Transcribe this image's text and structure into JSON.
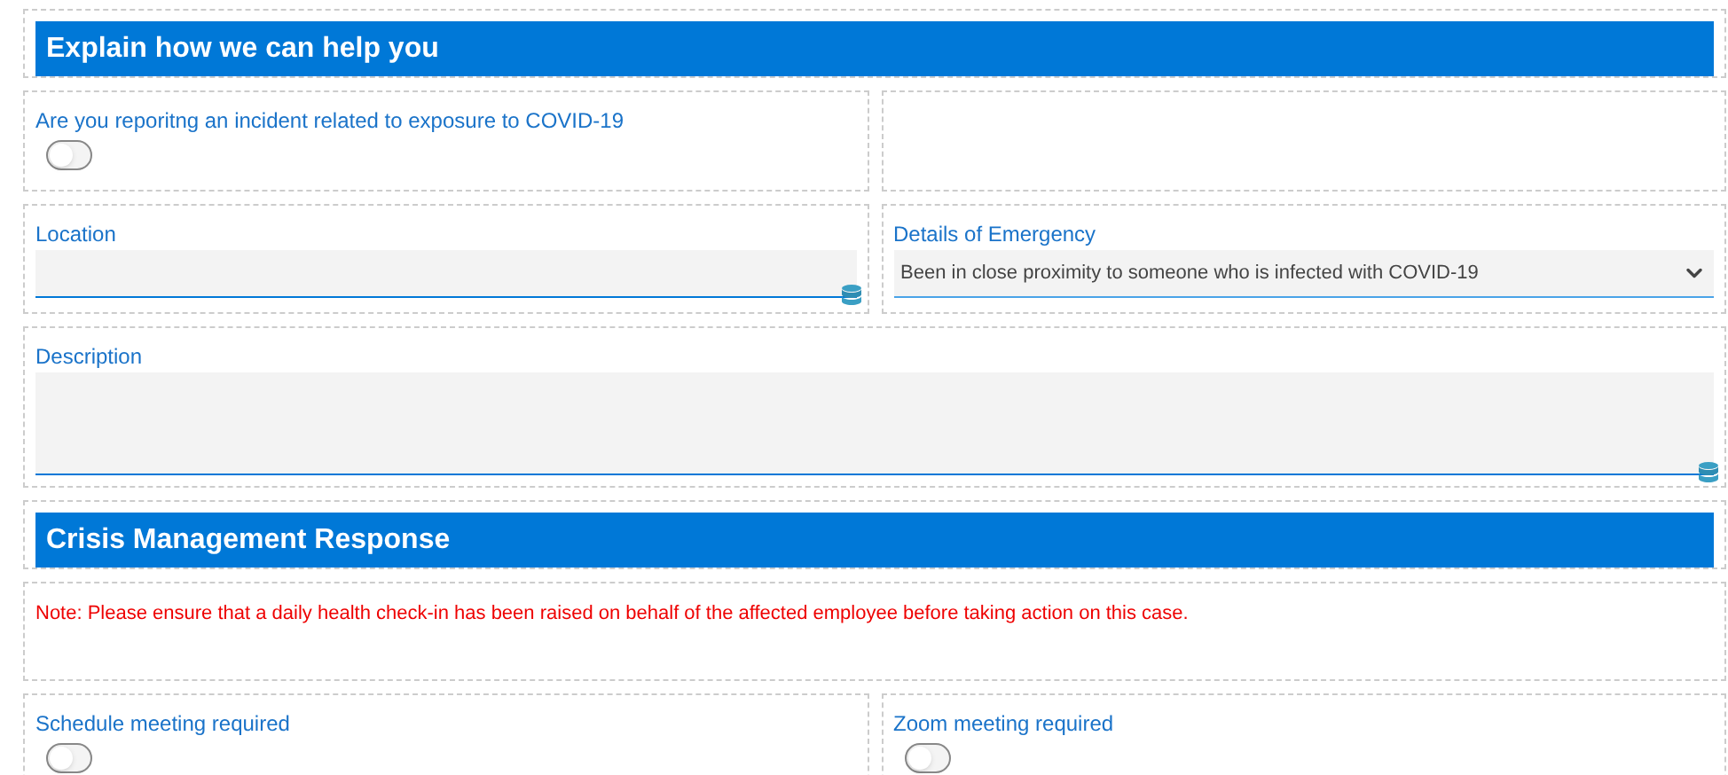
{
  "sections": [
    {
      "title": "Explain how we can help you",
      "rows": [
        [
          {
            "kind": "toggle",
            "label": "Are you reporitng an incident related to exposure to COVID-19",
            "on": false
          },
          {
            "kind": "empty"
          }
        ],
        [
          {
            "kind": "text",
            "label": "Location"
          },
          {
            "kind": "select",
            "label": "Details of Emergency",
            "value": "Been in close proximity to someone who is infected with COVID-19"
          }
        ],
        [
          {
            "kind": "textarea",
            "label": "Description"
          }
        ]
      ]
    },
    {
      "title": "Crisis Management Response",
      "rows": [
        [
          {
            "kind": "note",
            "text": "Note: Please ensure that a daily health check-in has been raised on behalf of the affected employee before taking action on this case."
          }
        ],
        [
          {
            "kind": "toggle",
            "label": "Schedule meeting required",
            "on": false
          },
          {
            "kind": "toggle",
            "label": "Zoom meeting required",
            "on": false
          }
        ]
      ]
    }
  ]
}
